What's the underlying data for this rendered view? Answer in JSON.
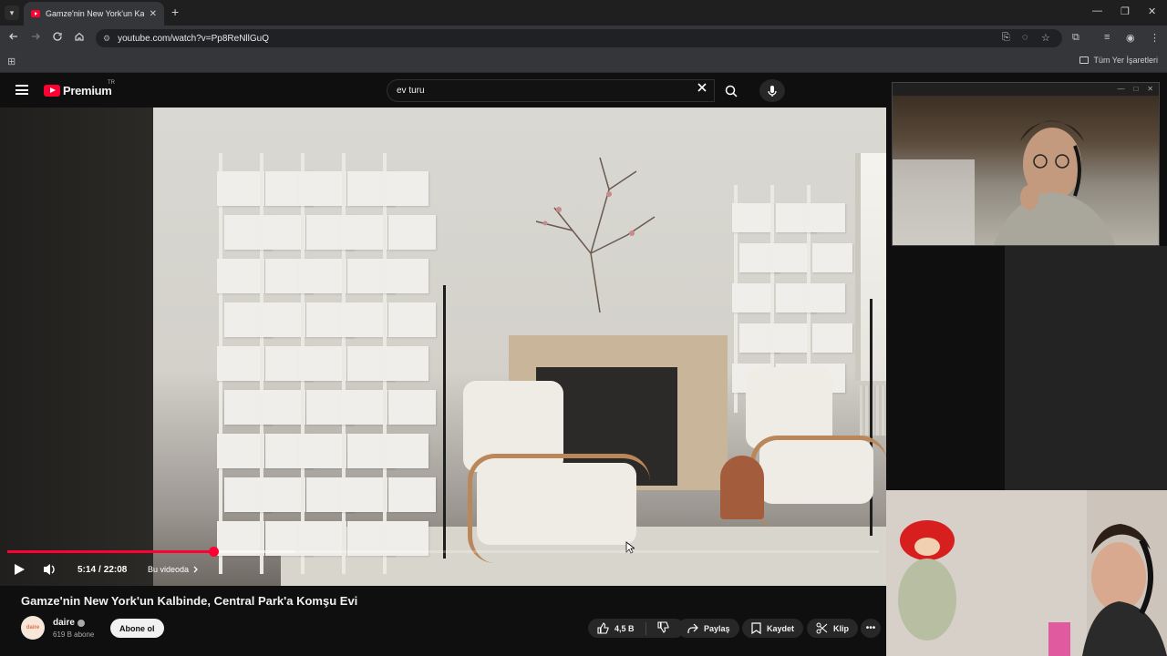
{
  "browser": {
    "tab_title": "Gamze'nin New York'un Kalbinde",
    "tab_close": "✕",
    "new_tab": "+",
    "url": "youtube.com/watch?v=Pp8ReNllGuQ",
    "bookmarks_all": "Tüm Yer İşaretleri",
    "win_min": "—",
    "win_max": "❐",
    "win_close": "✕"
  },
  "youtube": {
    "logo_text": "Premium",
    "region": "TR",
    "search_query": "ev turu"
  },
  "player": {
    "current_time": "5:14",
    "separator": "/",
    "duration": "22:08",
    "chapter_label": "Bu videoda",
    "progress_fraction": 0.236,
    "buffer_fraction": 0.33,
    "accent_color": "#ff0033"
  },
  "video": {
    "title": "Gamze'nin New York'un Kalbinde, Central Park'a Komşu Evi",
    "channel_name": "daire",
    "avatar_text": "daire",
    "subscribers": "619 B abone",
    "subscribe_label": "Abone ol",
    "like_count": "4,5 B",
    "share_label": "Paylaş",
    "save_label": "Kaydet",
    "clip_label": "Klip",
    "more_label": "•••"
  },
  "icons": [
    "tab-search-icon",
    "back-icon",
    "forward-icon",
    "reload-icon",
    "home-icon",
    "site-info-icon",
    "install-icon",
    "eye-off-icon",
    "star-icon",
    "extensions-icon",
    "reading-list-icon",
    "profile-icon",
    "menu-dots-icon",
    "apps-icon",
    "folder-icon",
    "hamburger-icon",
    "youtube-logo-icon",
    "clear-icon",
    "search-icon",
    "mic-icon",
    "play-icon",
    "volume-icon",
    "chevron-right-icon",
    "like-icon",
    "dislike-icon",
    "share-icon",
    "save-icon",
    "clip-icon",
    "more-icon",
    "verified-icon",
    "cursor-icon"
  ]
}
